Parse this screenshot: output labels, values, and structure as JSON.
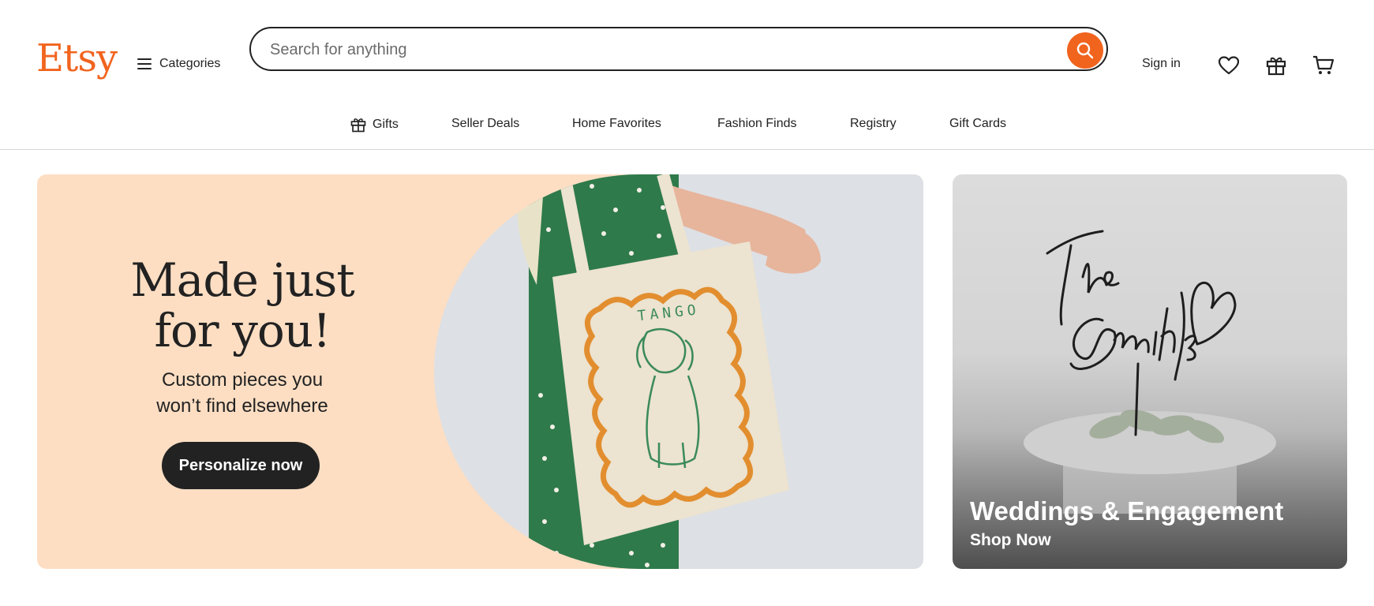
{
  "header": {
    "logo": "Etsy",
    "categories_label": "Categories",
    "search_placeholder": "Search for anything",
    "search_value": "",
    "sign_in": "Sign in"
  },
  "nav": {
    "items": [
      {
        "label": "Gifts",
        "icon": "gift-icon"
      },
      {
        "label": "Seller Deals"
      },
      {
        "label": "Home Favorites"
      },
      {
        "label": "Fashion Finds"
      },
      {
        "label": "Registry"
      },
      {
        "label": "Gift Cards"
      }
    ]
  },
  "hero": {
    "title_line1": "Made just",
    "title_line2": "for you!",
    "subtitle_line1": "Custom pieces you",
    "subtitle_line2": "won’t find elsewhere",
    "cta": "Personalize now",
    "image_text": "TANGO"
  },
  "side_card": {
    "title": "Weddings & Engagement",
    "link": "Shop Now"
  },
  "colors": {
    "brand": "#f1641e",
    "hero_bg": "#fddec3",
    "text": "#222222",
    "button_dark": "#222222"
  },
  "icons": [
    "menu-icon",
    "search-icon",
    "heart-icon",
    "gift-icon",
    "cart-icon"
  ]
}
